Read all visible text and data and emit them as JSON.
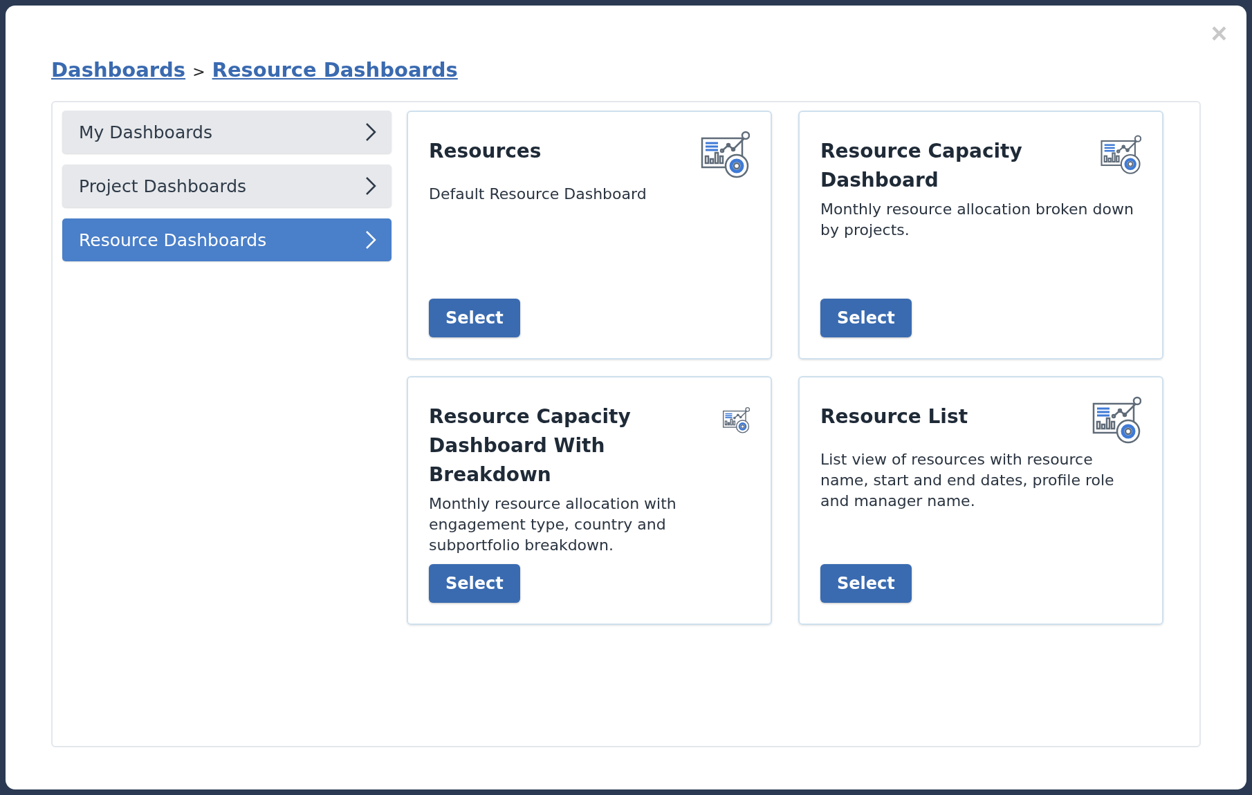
{
  "breadcrumb": [
    {
      "label": "Dashboards"
    },
    {
      "label": "Resource Dashboards"
    }
  ],
  "breadcrumb_separator": ">",
  "close_button": "×",
  "sidebar": {
    "items": [
      {
        "label": "My Dashboards",
        "selected": false
      },
      {
        "label": "Project Dashboards",
        "selected": false
      },
      {
        "label": "Resource Dashboards",
        "selected": true
      }
    ]
  },
  "cards": [
    {
      "title": "Resources",
      "description": "Default Resource Dashboard",
      "button": "Select"
    },
    {
      "title": "Resource Capacity Dashboard",
      "description": "Monthly resource allocation broken down by projects.",
      "button": "Select"
    },
    {
      "title": "Resource Capacity Dashboard With Breakdown",
      "description": "Monthly resource allocation with engagement type, country and subportfolio breakdown.",
      "button": "Select"
    },
    {
      "title": "Resource List",
      "description": "List view of resources with resource name, start and end dates, profile role and manager name.",
      "button": "Select"
    }
  ]
}
